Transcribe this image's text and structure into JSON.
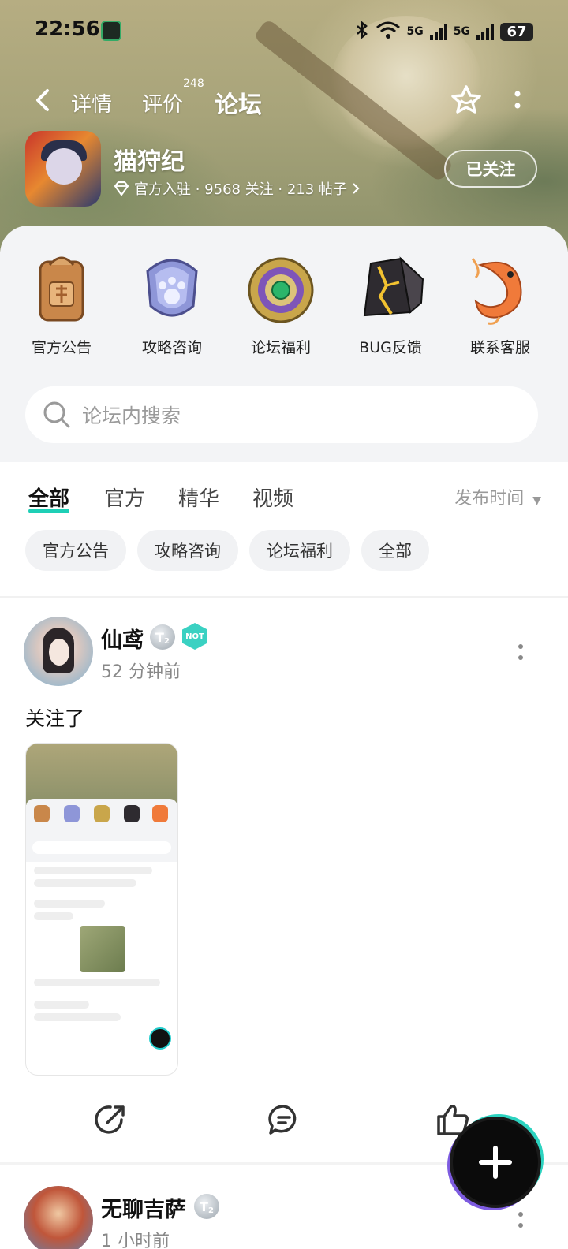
{
  "status_bar": {
    "time": "22:56",
    "net1": "5G",
    "net2": "5G",
    "battery": "67"
  },
  "nav": {
    "tabs": [
      {
        "label": "详情"
      },
      {
        "label": "评价",
        "badge": "248"
      },
      {
        "label": "论坛"
      }
    ],
    "active_tab": "论坛"
  },
  "game": {
    "title": "猫狩纪",
    "meta": "官方入驻 · 9568 关注 · 213 帖子",
    "follow_label": "已关注"
  },
  "categories": [
    {
      "label": "官方公告",
      "icon": "seal-icon"
    },
    {
      "label": "攻略咨询",
      "icon": "paw-badge-icon"
    },
    {
      "label": "论坛福利",
      "icon": "jade-medallion-icon"
    },
    {
      "label": "BUG反馈",
      "icon": "dark-crystal-icon"
    },
    {
      "label": "联系客服",
      "icon": "koi-fish-icon"
    }
  ],
  "search": {
    "placeholder": "论坛内搜索"
  },
  "filter_tabs": [
    {
      "label": "全部"
    },
    {
      "label": "官方"
    },
    {
      "label": "精华"
    },
    {
      "label": "视频"
    }
  ],
  "sort": {
    "label": "发布时间"
  },
  "chips": [
    {
      "label": "官方公告"
    },
    {
      "label": "攻略咨询"
    },
    {
      "label": "论坛福利"
    },
    {
      "label": "全部"
    }
  ],
  "posts": [
    {
      "user": "仙鸢",
      "level": "T",
      "level_num": "2",
      "hot_badge": "NOT",
      "time": "52 分钟前",
      "text": "关注了"
    },
    {
      "user": "无聊吉萨",
      "level": "T",
      "level_num": "2",
      "time": "1 小时前"
    }
  ],
  "colors": {
    "accent": "#1ecfb6"
  }
}
